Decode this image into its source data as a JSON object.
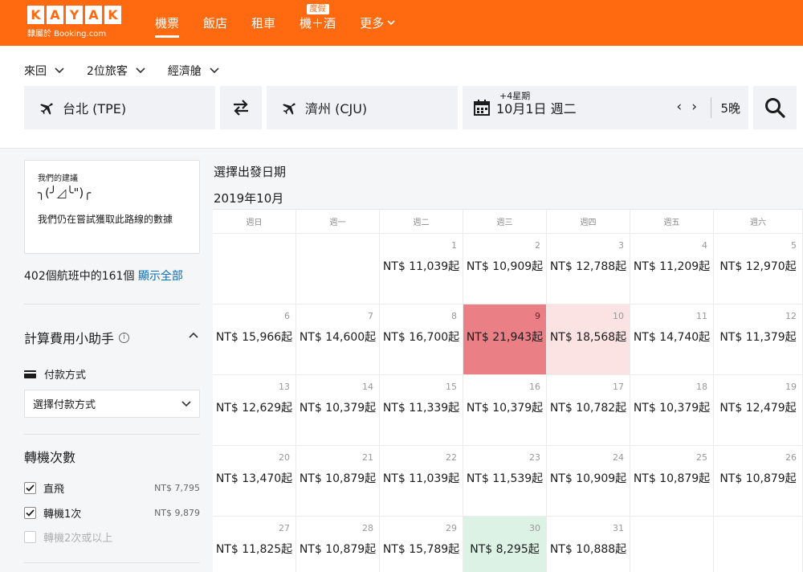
{
  "header": {
    "logo_letters": [
      "K",
      "A",
      "Y",
      "A",
      "K"
    ],
    "logo_sub": "隸屬於 Booking.com",
    "nav": [
      {
        "label": "機票",
        "active": true
      },
      {
        "label": "飯店"
      },
      {
        "label": "租車"
      },
      {
        "label": "機＋酒",
        "badge": "度假"
      },
      {
        "label": "更多",
        "chevron": true
      }
    ]
  },
  "search": {
    "trip_type": "來回",
    "travelers": "2位旅客",
    "cabin": "經濟艙",
    "origin": "台北 (TPE)",
    "destination": "濟州 (CJU)",
    "date_hint": "+4星期",
    "date": "10月1日 週二",
    "prev": "‹",
    "next": "›",
    "nights": "5晚"
  },
  "sidebar": {
    "suggest_title": "我們的建議",
    "suggest_face": "╮(╯◿╰\")╭",
    "suggest_msg": "我們仍在嘗試獲取此路線的數據",
    "count_text": "402個航班中的161個",
    "show_all": "顯示全部",
    "calc_title": "計算費用小助手",
    "info": "i",
    "pay_label": "付款方式",
    "pay_select": "選擇付款方式",
    "stops_title": "轉機次數",
    "stops": [
      {
        "label": "直飛",
        "price": "NT$ 7,795",
        "checked": true
      },
      {
        "label": "轉機1次",
        "price": "NT$ 9,879",
        "checked": true
      },
      {
        "label": "轉機2次或以上",
        "price": "",
        "checked": false,
        "disabled": true
      }
    ]
  },
  "calendar": {
    "title": "選擇出發日期",
    "month": "2019年10月",
    "weekdays": [
      "週日",
      "週一",
      "週二",
      "週三",
      "週四",
      "週五",
      "週六"
    ],
    "first_weekday": 2,
    "days": [
      {
        "day": "1",
        "price": "NT$ 11,039起"
      },
      {
        "day": "2",
        "price": "NT$ 10,909起"
      },
      {
        "day": "3",
        "price": "NT$ 12,788起"
      },
      {
        "day": "4",
        "price": "NT$ 11,209起"
      },
      {
        "day": "5",
        "price": "NT$ 12,970起"
      },
      {
        "day": "6",
        "price": "NT$ 15,966起"
      },
      {
        "day": "7",
        "price": "NT$ 14,600起"
      },
      {
        "day": "8",
        "price": "NT$ 16,700起"
      },
      {
        "day": "9",
        "price": "NT$ 21,943起",
        "level": "hot"
      },
      {
        "day": "10",
        "price": "NT$ 18,568起",
        "level": "warm"
      },
      {
        "day": "11",
        "price": "NT$ 14,740起"
      },
      {
        "day": "12",
        "price": "NT$ 11,379起"
      },
      {
        "day": "13",
        "price": "NT$ 12,629起"
      },
      {
        "day": "14",
        "price": "NT$ 10,379起"
      },
      {
        "day": "15",
        "price": "NT$ 11,339起"
      },
      {
        "day": "16",
        "price": "NT$ 10,379起"
      },
      {
        "day": "17",
        "price": "NT$ 10,782起"
      },
      {
        "day": "18",
        "price": "NT$ 10,379起"
      },
      {
        "day": "19",
        "price": "NT$ 12,479起"
      },
      {
        "day": "20",
        "price": "NT$ 13,470起"
      },
      {
        "day": "21",
        "price": "NT$ 10,879起"
      },
      {
        "day": "22",
        "price": "NT$ 11,039起"
      },
      {
        "day": "23",
        "price": "NT$ 11,539起"
      },
      {
        "day": "24",
        "price": "NT$ 10,909起"
      },
      {
        "day": "25",
        "price": "NT$ 10,879起"
      },
      {
        "day": "26",
        "price": "NT$ 10,879起"
      },
      {
        "day": "27",
        "price": "NT$ 11,825起"
      },
      {
        "day": "28",
        "price": "NT$ 10,879起"
      },
      {
        "day": "29",
        "price": "NT$ 15,789起"
      },
      {
        "day": "30",
        "price": "NT$ 8,295起",
        "level": "cool"
      },
      {
        "day": "31",
        "price": "NT$ 10,888起"
      }
    ]
  },
  "colors": {
    "brand": "#ff690f",
    "link": "#0a6ab5",
    "price_high": "#ea7f86",
    "price_mid": "#fbe2e3",
    "price_low": "#dcf2e5"
  }
}
